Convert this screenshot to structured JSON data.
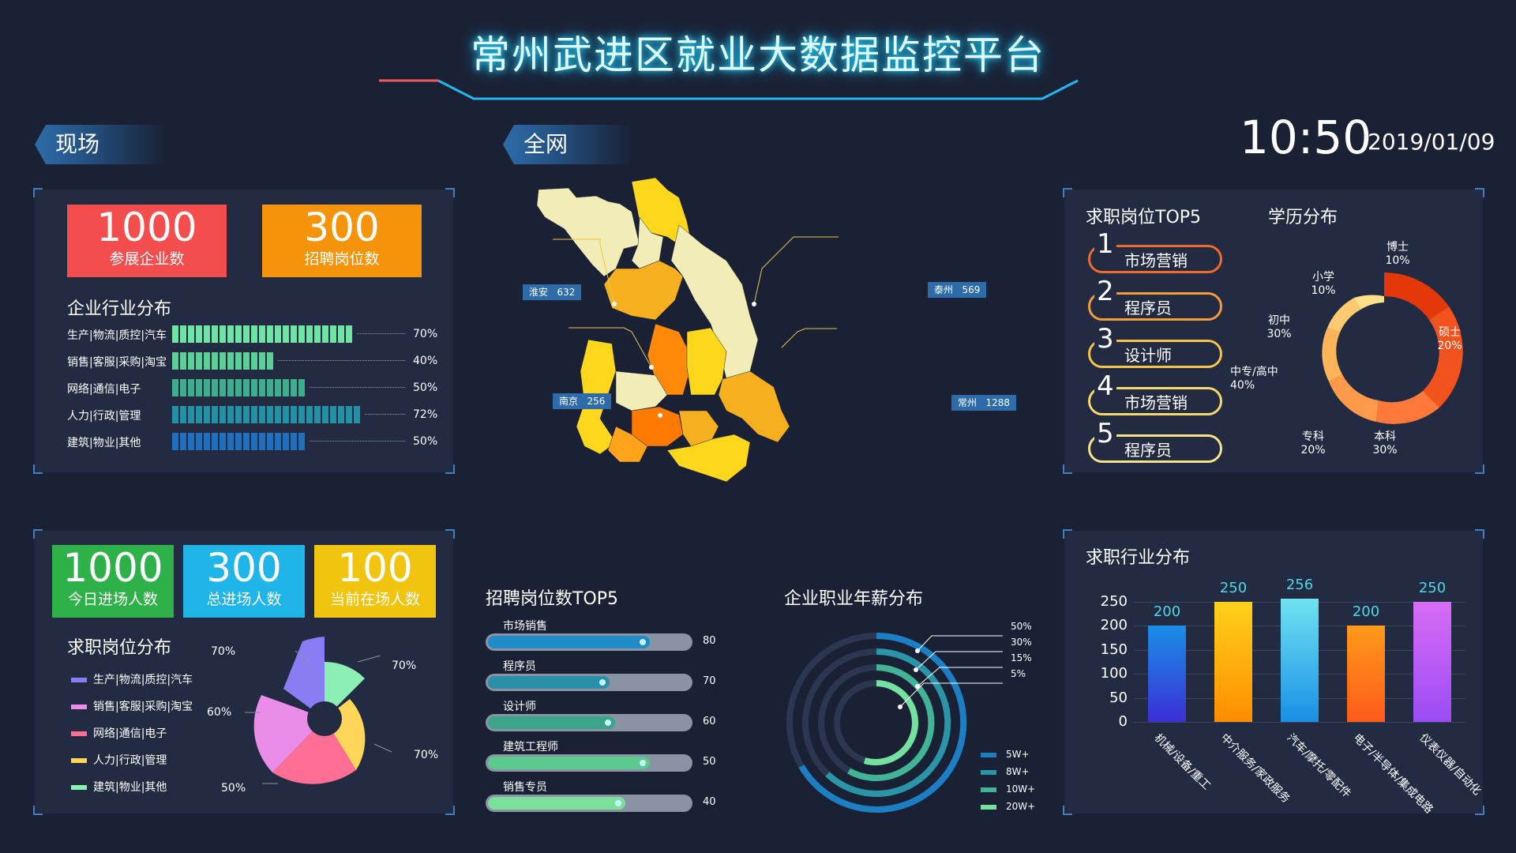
{
  "header": {
    "title": "常州武进区就业大数据监控平台"
  },
  "tags": {
    "onsite": "现场",
    "network": "全网"
  },
  "clock": {
    "time": "10:50",
    "date": "2019/01/09"
  },
  "onsite_stats": [
    {
      "value": "1000",
      "label": "参展企业数",
      "color": "#f44d4d"
    },
    {
      "value": "300",
      "label": "招聘岗位数",
      "color": "#f5940a"
    }
  ],
  "industry_dist": {
    "title": "企业行业分布",
    "rows": [
      {
        "label": "生产|物流|质控|汽车",
        "pct": "70%",
        "value": 70,
        "color": "#6fe3a4"
      },
      {
        "label": "销售|客服|采购|淘宝",
        "pct": "40%",
        "value": 40,
        "color": "#5ccf96"
      },
      {
        "label": "网络|通信|电子",
        "pct": "50%",
        "value": 50,
        "color": "#3eae8c"
      },
      {
        "label": "人力|行政|管理",
        "pct": "72%",
        "value": 72,
        "color": "#2391a3"
      },
      {
        "label": "建筑|物业|其他",
        "pct": "50%",
        "value": 50,
        "color": "#1f6fbe"
      }
    ]
  },
  "visit_stats": [
    {
      "value": "1000",
      "label": "今日进场人数",
      "color": "#2fb14a"
    },
    {
      "value": "300",
      "label": "总进场人数",
      "color": "#1fb5e8"
    },
    {
      "value": "100",
      "label": "当前在场人数",
      "color": "#f1c40f"
    }
  ],
  "job_dist": {
    "title": "求职岗位分布",
    "legend": [
      {
        "label": "生产|物流|质控|汽车",
        "color": "#8a7cf2"
      },
      {
        "label": "销售|客服|采购|淘宝",
        "color": "#e98de9"
      },
      {
        "label": "网络|通信|电子",
        "color": "#ff6e94"
      },
      {
        "label": "人力|行政|管理",
        "color": "#ffd55a"
      },
      {
        "label": "建筑|物业|其他",
        "color": "#8cf0b4"
      }
    ],
    "callouts": [
      "70%",
      "70%",
      "60%",
      "70%",
      "50%"
    ]
  },
  "map": {
    "cities": [
      {
        "name": "淮安",
        "value": "632"
      },
      {
        "name": "泰州",
        "value": "569"
      },
      {
        "name": "南京",
        "value": "256"
      },
      {
        "name": "常州",
        "value": "1288"
      }
    ]
  },
  "recruit_top5": {
    "title": "招聘岗位数TOP5",
    "rows": [
      {
        "label": "市场销售",
        "value": "80",
        "fill": 80,
        "color": "#1f8cc9"
      },
      {
        "label": "程序员",
        "value": "70",
        "fill": 60,
        "color": "#2a8fa8"
      },
      {
        "label": "设计师",
        "value": "60",
        "fill": 63,
        "color": "#3aa58a"
      },
      {
        "label": "建筑工程师",
        "value": "50",
        "fill": 80,
        "color": "#5cc98f"
      },
      {
        "label": "销售专员",
        "value": "40",
        "fill": 68,
        "color": "#7be09c"
      }
    ]
  },
  "salary": {
    "title": "企业职业年薪分布",
    "rings": [
      {
        "pct": "50%",
        "label": "5W+",
        "color": "#1c7fc4"
      },
      {
        "pct": "30%",
        "label": "8W+",
        "color": "#2a94a8"
      },
      {
        "pct": "15%",
        "label": "10W+",
        "color": "#42b496"
      },
      {
        "pct": "5%",
        "label": "20W+",
        "color": "#74e29e"
      }
    ]
  },
  "job_top5": {
    "title": "求职岗位TOP5",
    "items": [
      {
        "num": "1",
        "label": "市场营销",
        "color": "#f06a2a"
      },
      {
        "num": "2",
        "label": "程序员",
        "color": "#f59a3a"
      },
      {
        "num": "3",
        "label": "设计师",
        "color": "#f7c34a"
      },
      {
        "num": "4",
        "label": "市场营销",
        "color": "#f7d86a"
      },
      {
        "num": "5",
        "label": "程序员",
        "color": "#f5e38a"
      }
    ]
  },
  "education": {
    "title": "学历分布",
    "labels": [
      {
        "name": "博士",
        "pct": "10%"
      },
      {
        "name": "硕士",
        "pct": "20%"
      },
      {
        "name": "本科",
        "pct": "30%"
      },
      {
        "name": "专科",
        "pct": "20%"
      },
      {
        "name": "中专/高中",
        "pct": "40%"
      },
      {
        "name": "初中",
        "pct": "30%"
      },
      {
        "name": "小学",
        "pct": "10%"
      }
    ]
  },
  "industry_job": {
    "title": "求职行业分布",
    "chart_data": {
      "type": "bar",
      "categories": [
        "机械/设备/重工",
        "中介服务/家政服务",
        "汽车/摩托/零配件",
        "电子/半导体/集成电路",
        "仪表仪器/自动化"
      ],
      "values": [
        200,
        250,
        256,
        200,
        250
      ],
      "ylim": [
        0,
        250
      ],
      "yticks": [
        "250",
        "200",
        "150",
        "100",
        "50",
        "0"
      ],
      "colors": [
        [
          "#1a8fe6",
          "#3b2fd6"
        ],
        [
          "#ffd21a",
          "#ff8c00"
        ],
        [
          "#6fe3f0",
          "#1a8fe6"
        ],
        [
          "#ff9a1a",
          "#ff5a1a"
        ],
        [
          "#d86cf5",
          "#9a4cf5"
        ]
      ]
    }
  }
}
